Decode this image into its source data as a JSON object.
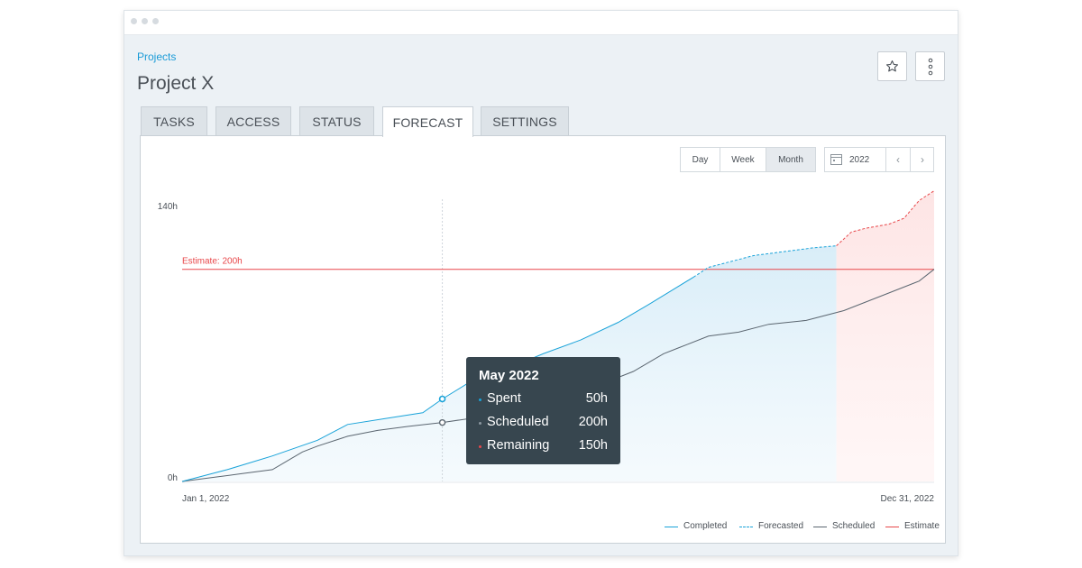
{
  "breadcrumb": "Projects",
  "page_title": "Project X",
  "header_actions": {
    "star_icon": "star-icon",
    "more_icon": "vertical-dots-icon"
  },
  "tabs": [
    {
      "label": "TASKS",
      "active": false
    },
    {
      "label": "ACCESS",
      "active": false
    },
    {
      "label": "STATUS",
      "active": false
    },
    {
      "label": "FORECAST",
      "active": true
    },
    {
      "label": "SETTINGS",
      "active": false
    }
  ],
  "range_selector": {
    "options": [
      "Day",
      "Week",
      "Month"
    ],
    "selected": "Month"
  },
  "year_picker": {
    "icon": "calendar-icon",
    "value": "2022",
    "prev_icon": "chevron-left-icon",
    "next_icon": "chevron-right-icon"
  },
  "colors": {
    "completed": "#1aa3d9",
    "scheduled": "#5b6670",
    "estimate": "#e8474a",
    "tooltip_bg": "#37464f",
    "accent": "#1a9bd7"
  },
  "tooltip": {
    "title": "May 2022",
    "rows": [
      {
        "label": "Spent",
        "value": "50h",
        "color": "#1aa3d9"
      },
      {
        "label": "Scheduled",
        "value": "200h",
        "color": "#8b97a0"
      },
      {
        "label": "Remaining",
        "value": "150h",
        "color": "#e8474a"
      }
    ]
  },
  "chart_data": {
    "type": "line",
    "y_ticks": [
      "140h",
      "0h"
    ],
    "x_start_label": "Jan 1, 2022",
    "x_end_label": "Dec 31, 2022",
    "ylim": [
      0,
      140
    ],
    "estimate": {
      "label": "Estimate: 200h",
      "value": 108
    },
    "hover_x": 0.346,
    "series": [
      {
        "name": "Completed",
        "style": "solid",
        "x": [
          0,
          0.06,
          0.12,
          0.18,
          0.22,
          0.27,
          0.32,
          0.346,
          0.38,
          0.43,
          0.48,
          0.53,
          0.58,
          0.62,
          0.65,
          0.68
        ],
        "y": [
          0,
          6,
          13,
          21,
          29,
          32,
          35,
          42,
          50,
          57,
          65,
          72,
          81,
          90,
          97,
          104
        ]
      },
      {
        "name": "Forecasted",
        "style": "dashed",
        "x": [
          0.68,
          0.7,
          0.73,
          0.76,
          0.8,
          0.84,
          0.87
        ],
        "y": [
          104,
          109,
          112,
          115,
          117,
          119,
          120
        ]
      },
      {
        "name": "Scheduled",
        "style": "solid",
        "x": [
          0,
          0.04,
          0.08,
          0.12,
          0.16,
          0.18,
          0.22,
          0.26,
          0.3,
          0.346,
          0.4,
          0.44,
          0.48,
          0.52,
          0.56,
          0.6,
          0.64,
          0.66,
          0.7,
          0.74,
          0.78,
          0.83,
          0.88,
          0.94,
          0.98,
          1.0
        ],
        "y": [
          0,
          2,
          4,
          6,
          15,
          18,
          23,
          26,
          28,
          30,
          33,
          36,
          40,
          45,
          50,
          56,
          65,
          68,
          74,
          76,
          80,
          82,
          87,
          96,
          102,
          108
        ]
      },
      {
        "name": "Estimate",
        "style": "dashed",
        "x": [
          0.87,
          0.89,
          0.91,
          0.94,
          0.96,
          0.98,
          1.0
        ],
        "y": [
          120,
          127,
          129,
          131,
          134,
          143,
          148
        ]
      }
    ],
    "legend": [
      "Completed",
      "Forecasted",
      "Scheduled",
      "Estimate"
    ],
    "legend_position": "bottom-right"
  }
}
